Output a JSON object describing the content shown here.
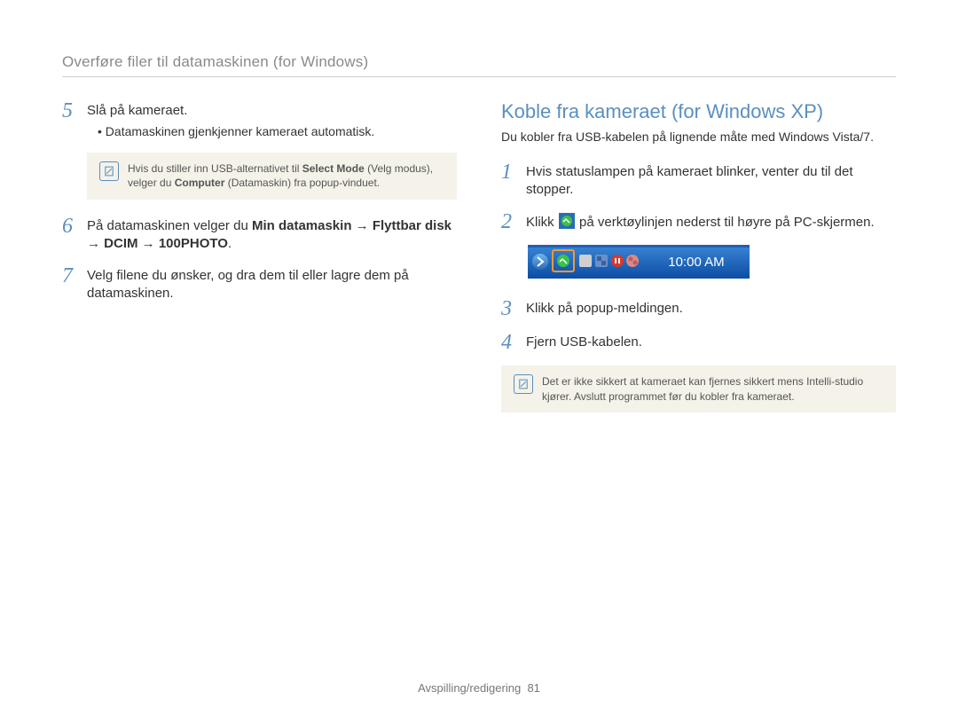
{
  "header": {
    "title": "Overføre filer til datamaskinen (for Windows)"
  },
  "left": {
    "step5_num": "5",
    "step5_text": "Slå på kameraet.",
    "step5_bullet": "Datamaskinen gjenkjenner kameraet automatisk.",
    "note1_prefix": "Hvis du stiller inn USB-alternativet til ",
    "note1_bold1": "Select Mode",
    "note1_mid": " (Velg modus), velger du ",
    "note1_bold2": "Computer",
    "note1_suffix": " (Datamaskin) fra popup-vinduet.",
    "step6_num": "6",
    "step6_prefix": "På datamaskinen velger du ",
    "step6_bold": "Min datamaskin → Flyttbar disk → DCIM → 100PHOTO",
    "step6_suffix": ".",
    "step7_num": "7",
    "step7_text": "Velg filene du ønsker, og dra dem til eller lagre dem på datamaskinen."
  },
  "right": {
    "title": "Koble fra kameraet (for Windows XP)",
    "sub": "Du kobler fra USB-kabelen på lignende måte med Windows Vista/7.",
    "step1_num": "1",
    "step1_text": "Hvis statuslampen på kameraet blinker, venter du til det stopper.",
    "step2_num": "2",
    "step2_prefix": "Klikk ",
    "step2_suffix": " på verktøylinjen nederst til høyre på PC-skjermen.",
    "tray_time": "10:00 AM",
    "step3_num": "3",
    "step3_text": "Klikk på popup-meldingen.",
    "step4_num": "4",
    "step4_text": "Fjern USB-kabelen.",
    "note2_text": "Det er ikke sikkert at kameraet kan fjernes sikkert mens Intelli-studio kjører. Avslutt programmet før du kobler fra kameraet."
  },
  "footer": {
    "section": "Avspilling/redigering",
    "page": "81"
  }
}
